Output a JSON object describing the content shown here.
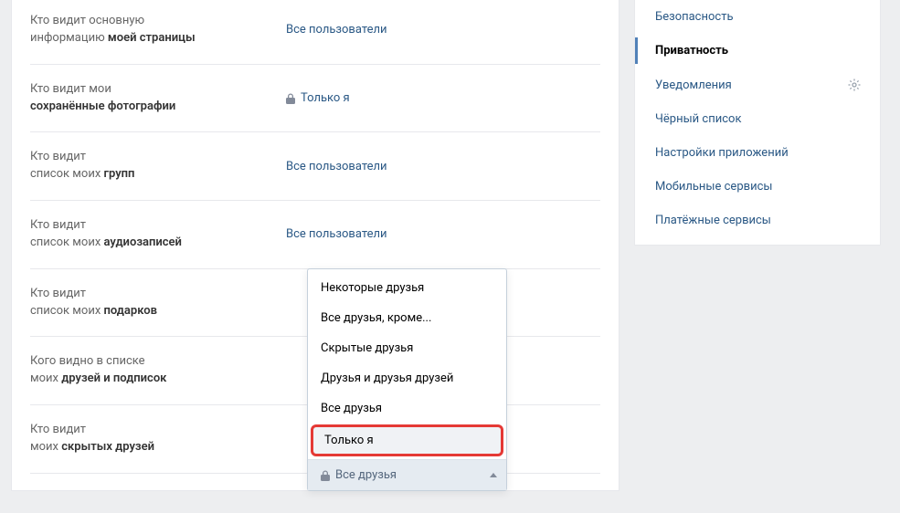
{
  "settings": {
    "rows": [
      {
        "label_pre": "Кто видит основную",
        "label_bold": "моей страницы",
        "label_mid": "информацию ",
        "value": "Все пользователи",
        "locked": false
      },
      {
        "label_pre": "Кто видит мои",
        "label_bold": "сохранённые фотографии",
        "label_mid": "",
        "value": "Только я",
        "locked": true
      },
      {
        "label_pre": "Кто видит",
        "label_bold": "групп",
        "label_mid": "список моих ",
        "value": "Все пользователи",
        "locked": false
      },
      {
        "label_pre": "Кто видит",
        "label_bold": "аудиозаписей",
        "label_mid": "список моих ",
        "value": "Все пользователи",
        "locked": false
      },
      {
        "label_pre": "Кто видит",
        "label_bold": "подарков",
        "label_mid": "список моих ",
        "value": "",
        "locked": false
      },
      {
        "label_pre": "Кого видно в списке",
        "label_bold": "друзей и подписок",
        "label_mid": "моих ",
        "value": "",
        "locked": false
      },
      {
        "label_pre": "Кто видит",
        "label_bold": "скрытых друзей",
        "label_mid": "моих ",
        "value": "",
        "locked": false
      }
    ]
  },
  "dropdown": {
    "options": [
      "Некоторые друзья",
      "Все друзья, кроме...",
      "Скрытые друзья",
      "Друзья и друзья друзей",
      "Все друзья",
      "Только я"
    ],
    "selected": "Все друзья"
  },
  "sidebar": {
    "items": [
      {
        "label": "Безопасность",
        "active": false
      },
      {
        "label": "Приватность",
        "active": true
      },
      {
        "label": "Уведомления",
        "active": false,
        "gear": true
      },
      {
        "label": "Чёрный список",
        "active": false
      },
      {
        "label": "Настройки приложений",
        "active": false
      },
      {
        "label": "Мобильные сервисы",
        "active": false
      },
      {
        "label": "Платёжные сервисы",
        "active": false
      }
    ]
  }
}
